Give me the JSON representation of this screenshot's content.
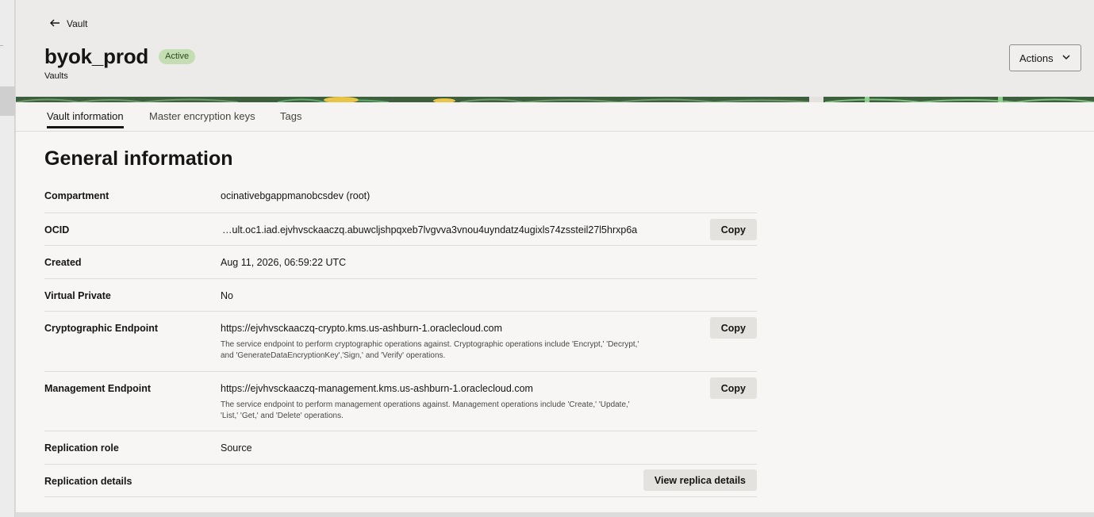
{
  "breadcrumb": {
    "back_label": "Vault"
  },
  "header": {
    "title": "byok_prod",
    "status": "Active",
    "subtitle": "Vaults",
    "actions_label": "Actions"
  },
  "tabs": [
    {
      "label": "Vault information",
      "active": true
    },
    {
      "label": "Master encryption keys",
      "active": false
    },
    {
      "label": "Tags",
      "active": false
    }
  ],
  "general": {
    "title": "General information",
    "rows": {
      "compartment": {
        "label": "Compartment",
        "value": "ocinativebgappmanobcsdev (root)"
      },
      "ocid": {
        "label": "OCID",
        "value": "…ult.oc1.iad.ejvhvsckaaczq.abuwcljshpqxeb7lvgvva3vnou4uyndatz4ugixls74zssteil27l5hrxp6a",
        "copy_label": "Copy"
      },
      "created": {
        "label": "Created",
        "value": "Aug 11, 2026, 06:59:22 UTC"
      },
      "virtual_private": {
        "label": "Virtual Private",
        "value": "No"
      },
      "crypto_endpoint": {
        "label": "Cryptographic Endpoint",
        "value": "https://ejvhvsckaaczq-crypto.kms.us-ashburn-1.oraclecloud.com",
        "description": "The service endpoint to perform cryptographic operations against. Cryptographic operations include 'Encrypt,' 'Decrypt,' and 'GenerateDataEncryptionKey','Sign,' and 'Verify' operations.",
        "copy_label": "Copy"
      },
      "management_endpoint": {
        "label": "Management Endpoint",
        "value": "https://ejvhvsckaaczq-management.kms.us-ashburn-1.oraclecloud.com",
        "description": "The service endpoint to perform management operations against. Management operations include 'Create,' 'Update,' 'List,' 'Get,' and 'Delete' operations.",
        "copy_label": "Copy"
      },
      "replication_role": {
        "label": "Replication role",
        "value": "Source"
      },
      "replication_details": {
        "label": "Replication details",
        "button_label": "View replica details"
      }
    }
  },
  "colors": {
    "status_badge": "#c5ddb3",
    "banner_green": "#3d5f3d",
    "banner_accent": "#e8c547"
  }
}
